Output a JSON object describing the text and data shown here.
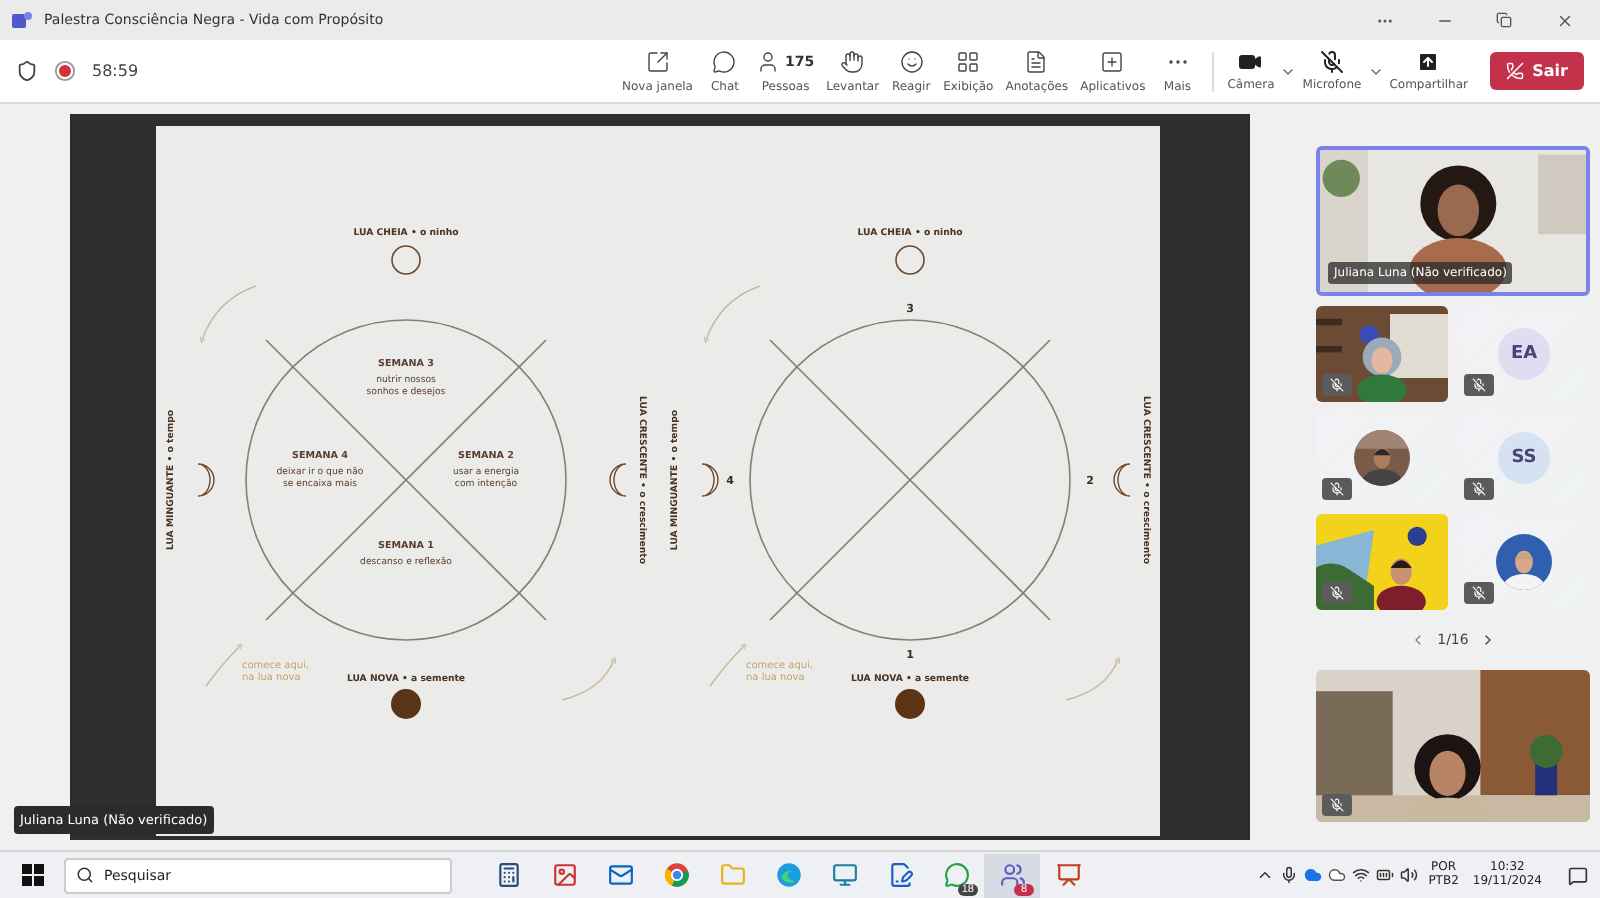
{
  "window": {
    "title": "Palestra Consciência Negra - Vida com Propósito"
  },
  "meeting": {
    "timer": "58:59",
    "recording": true
  },
  "actions": [
    {
      "label": "Nova janela"
    },
    {
      "label": "Chat"
    },
    {
      "label": "Pessoas",
      "count": "175"
    },
    {
      "label": "Levantar"
    },
    {
      "label": "Reagir"
    },
    {
      "label": "Exibição"
    },
    {
      "label": "Anotações"
    },
    {
      "label": "Aplicativos"
    },
    {
      "label": "Mais"
    }
  ],
  "devices": [
    {
      "label": "Câmera",
      "muted": false
    },
    {
      "label": "Microfone",
      "muted": true
    }
  ],
  "share": {
    "label": "Compartilhar"
  },
  "leave": {
    "label": "Sair"
  },
  "slide": {
    "diagrams": [
      {
        "kind": "weeks",
        "moons": [
          "LUA CHEIA • o ninho",
          "LUA MINGUANTE • o tempo",
          "LUA CRESCENTE • o crescimento",
          "LUA NOVA • a semente"
        ],
        "weeks": [
          {
            "title": "SEMANA 3",
            "text": [
              "nutrir nossos",
              "sonhos e desejos"
            ]
          },
          {
            "title": "SEMANA 4",
            "text": [
              "deixar ir o que não",
              "se encaixa mais"
            ]
          },
          {
            "title": "SEMANA 2",
            "text": [
              "usar a energia",
              "com intenção"
            ]
          },
          {
            "title": "SEMANA 1",
            "text": [
              "descanso e reflexão"
            ]
          }
        ],
        "start_note": [
          "comece aqui,",
          "na lua nova"
        ]
      },
      {
        "kind": "numbers",
        "moons": [
          "LUA CHEIA • o ninho",
          "LUA MINGUANTE • o tempo",
          "LUA CRESCENTE • o crescimento",
          "LUA NOVA • a semente"
        ],
        "numbers": [
          "3",
          "4",
          "2",
          "1"
        ],
        "start_note": [
          "comece aqui,",
          "na lua nova"
        ]
      }
    ]
  },
  "presenter": {
    "name": "Juliana Luna (Não verificado)"
  },
  "gallery": {
    "spotlight": {
      "name": "Juliana Luna (Não verificado)",
      "selected": true
    },
    "tiles": [
      {
        "kind": "video",
        "muted": true
      },
      {
        "kind": "initials",
        "initials": "EA",
        "muted": true
      },
      {
        "kind": "avatar",
        "muted": true
      },
      {
        "kind": "initials",
        "initials": "SS",
        "muted": true
      },
      {
        "kind": "video",
        "muted": true
      },
      {
        "kind": "avatar",
        "muted": true
      }
    ],
    "pager": "1/16"
  },
  "self_view": {
    "muted": true
  },
  "taskbar": {
    "search": {
      "placeholder": "Pesquisar"
    },
    "apps": [
      {
        "selected": false
      },
      {
        "selected": false
      },
      {
        "selected": false
      },
      {
        "selected": false
      },
      {
        "selected": false
      },
      {
        "selected": false
      },
      {
        "selected": false
      },
      {
        "selected": false
      },
      {
        "selected": false,
        "badge": "18"
      },
      {
        "selected": true,
        "badge": "8"
      },
      {
        "selected": false
      }
    ],
    "tray": {
      "language": "POR",
      "layout": "PTB2",
      "time": "10:32",
      "date": "19/11/2024"
    }
  }
}
